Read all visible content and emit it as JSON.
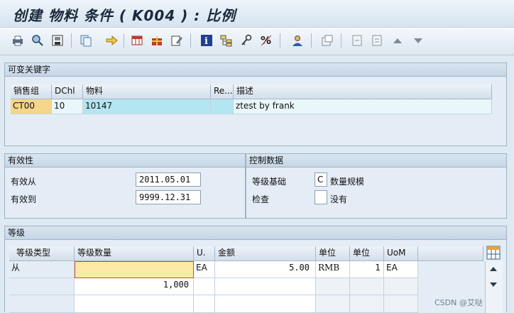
{
  "window": {
    "title": "创建 物料 条件 ( K004 ) : 比例"
  },
  "colors": {
    "title_bar": "#dbe6f0",
    "panel_bg": "#e4edf5",
    "header_bg": "#d0dde9",
    "key_highlight": "#f5d68a",
    "input_highlight": "#fde9a6",
    "material_cell": "#b4e6f2",
    "selected_row": "#e9f7fb"
  },
  "toolbar": {
    "icons": [
      "print-icon",
      "find-icon",
      "save-local-icon",
      "copy-icon",
      "forward-icon",
      "table-icon",
      "gift-icon",
      "edit-icon",
      "info-icon",
      "structure-icon",
      "key-tool-icon",
      "percent-icon",
      "user-icon",
      "window-icon",
      "page-prev-icon",
      "page-next-icon",
      "arrow-up-icon",
      "arrow-down-icon"
    ]
  },
  "variable_key": {
    "title": "可变关键字",
    "columns": [
      "销售组",
      "DChl",
      "物料",
      "Re...",
      "描述"
    ],
    "row": {
      "sales_group": "CT00",
      "dchl": "10",
      "material": "10147",
      "re": "",
      "description": "ztest by frank"
    }
  },
  "validity": {
    "title": "有效性",
    "valid_from_label": "有效从",
    "valid_from": "2011.05.01",
    "valid_to_label": "有效到",
    "valid_to": "9999.12.31"
  },
  "control": {
    "title": "控制数据",
    "scale_base_label": "等级基础",
    "scale_base_code": "C",
    "scale_base_text": "数量规模",
    "check_label": "检查",
    "check_code": "",
    "check_text": "没有"
  },
  "scales": {
    "title": "等级",
    "columns": [
      "等级类型",
      "等级数量",
      "U.",
      "金额",
      "单位",
      "单位",
      "UoM"
    ],
    "rows": [
      {
        "type": "从",
        "qty": "",
        "u": "EA",
        "amount": "5.00",
        "unit1": "RMB",
        "unit2": "1",
        "uom": "EA"
      },
      {
        "type": "",
        "qty": "1,000",
        "u": "",
        "amount": "",
        "unit1": "",
        "unit2": "",
        "uom": ""
      },
      {
        "type": "",
        "qty": "",
        "u": "",
        "amount": "",
        "unit1": "",
        "unit2": "",
        "uom": ""
      }
    ]
  },
  "watermark": "CSDN @艾哒"
}
